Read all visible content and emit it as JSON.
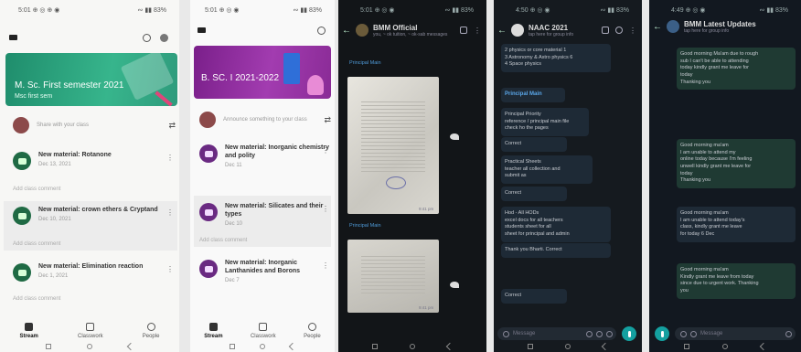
{
  "phone1": {
    "status_left": "5:01 ⊕ ◎ ⊕ ◉",
    "status_right": "∾ ▮▮ 83%",
    "banner_title": "M. Sc. First semester 2021",
    "banner_sub": "Msc first sem",
    "banner_color": "#2a9d7a",
    "announce_placeholder": "Share with your class",
    "posts": [
      {
        "title": "New material: Rotanone",
        "date": "Dec 13, 2021",
        "comment": "Add class comment"
      },
      {
        "title": "New material: crown ethers & Cryptand",
        "date": "Dec 10, 2021",
        "comment": "Add class comment"
      },
      {
        "title": "New material: Elimination reaction",
        "date": "Dec 1, 2021",
        "comment": "Add class comment"
      }
    ],
    "nav": [
      "Stream",
      "Classwork",
      "People"
    ]
  },
  "phone2": {
    "status_left": "5:01 ⊕ ◎ ◉",
    "status_right": "∾ ▮▮ 83%",
    "banner_title": "B. SC. I 2021-2022",
    "banner_color": "#8a2b96",
    "announce_placeholder": "Announce something to your class",
    "posts": [
      {
        "title": "New material: Inorganic chemistry and polity",
        "date": "Dec 11"
      },
      {
        "title": "New material: Silicates and their types",
        "date": "Dec 10",
        "comment": "Add class comment"
      },
      {
        "title": "New material: Inorganic Lanthanides and Borons",
        "date": "Dec 7"
      }
    ],
    "nav": [
      "Stream",
      "Classwork",
      "People"
    ]
  },
  "phone3": {
    "status_left": "5:01 ⊕ ◎ ◉",
    "status_right": "∾ ▮▮ 83%",
    "chat_name": "BMM Official",
    "chat_sub": "you, ~ ok tuition, ~ ok-sab messages",
    "pinned1": "Principal Main",
    "pinned2": "Principal Main",
    "time1": "9:41 pm",
    "time2": "9:41 pm"
  },
  "phone4": {
    "status_left": "4:50 ⊕ ◎ ◉",
    "status_right": "∾ ▮▮ 83%",
    "chat_name": "NAAC 2021",
    "chat_sub": "tap here for group info",
    "msg1": "2 physics or core material 1\n3 Astronomy & Astro physics 6\n4 Space physics",
    "msg2": "Principal Main",
    "msg3": "Principal Priority\nreference / principal main file\ncheck ho the pages",
    "msg4": "Correct",
    "msg5": "Practical Sheets\nteacher all collection and\nsubmit as",
    "msg6": "Correct",
    "msg7": "Hod - All HODs\nexcel docs for all teachers\nstudents sheet for all\nsheet for principal and admin",
    "msg8": "Thank you Bharti. Correct",
    "msg9": "Correct",
    "input_placeholder": "Message"
  },
  "phone5": {
    "status_left": "4:49 ⊕ ◎ ◉",
    "status_right": "∾ ▮▮ 83%",
    "chat_name": "BMM Latest Updates",
    "chat_sub": "tap here for group info",
    "msg1": "Good morning Ma'am due to rough\nsub I can't be able to attending\ntoday kindly grant me leave for\ntoday\nThanking you",
    "msg2": "Good morning ma'am\nI am unable to attend my\nonline today because I'm feeling\nunwell kindly grant me leave for\ntoday\nThanking you",
    "msg3": "Good morning ma'am\nI am unable to attend today's\nclass, kindly grant me leave\nfor today 6 Dec",
    "msg4": "Good morning ma'am\nKindly grant me leave from today\nsince due to urgent work. Thanking\nyou",
    "input_placeholder": "Message"
  }
}
